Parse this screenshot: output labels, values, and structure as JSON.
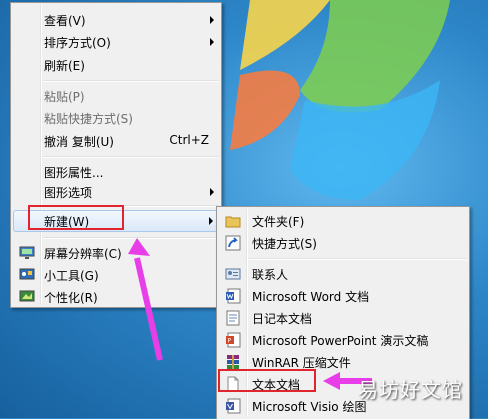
{
  "main_menu": {
    "items": [
      {
        "label": "查看(V)",
        "submenu": true
      },
      {
        "label": "排序方式(O)",
        "submenu": true
      },
      {
        "label": "刷新(E)"
      },
      {
        "label": "粘贴(P)",
        "disabled": true
      },
      {
        "label": "粘贴快捷方式(S)",
        "disabled": true
      },
      {
        "label": "撤消 复制(U)",
        "shortcut": "Ctrl+Z"
      },
      {
        "label": "图形属性..."
      },
      {
        "label": "图形选项",
        "submenu": true
      },
      {
        "label": "新建(W)",
        "submenu": true,
        "highlighted": true
      },
      {
        "label": "屏幕分辨率(C)",
        "icon": "screen-resolution-icon"
      },
      {
        "label": "小工具(G)",
        "icon": "gadgets-icon"
      },
      {
        "label": "个性化(R)",
        "icon": "personalize-icon"
      }
    ]
  },
  "new_submenu": {
    "items": [
      {
        "label": "文件夹(F)",
        "icon": "folder-icon"
      },
      {
        "label": "快捷方式(S)",
        "icon": "shortcut-icon"
      },
      {
        "label": "联系人",
        "icon": "contact-icon"
      },
      {
        "label": "Microsoft Word 文档",
        "icon": "word-doc-icon"
      },
      {
        "label": "日记本文档",
        "icon": "journal-doc-icon"
      },
      {
        "label": "Microsoft PowerPoint 演示文稿",
        "icon": "powerpoint-icon"
      },
      {
        "label": "WinRAR 压缩文件",
        "icon": "winrar-icon"
      },
      {
        "label": "文本文档",
        "icon": "text-doc-icon",
        "highlighted_box": true
      },
      {
        "label": "Microsoft Visio 绘图",
        "icon": "visio-icon"
      }
    ]
  },
  "watermark": {
    "text": "易坊好文馆"
  },
  "colors": {
    "annotation_red": "#e0252f",
    "arrow_magenta": "#e83ee8",
    "menu_bg": "#f0f0f0"
  }
}
